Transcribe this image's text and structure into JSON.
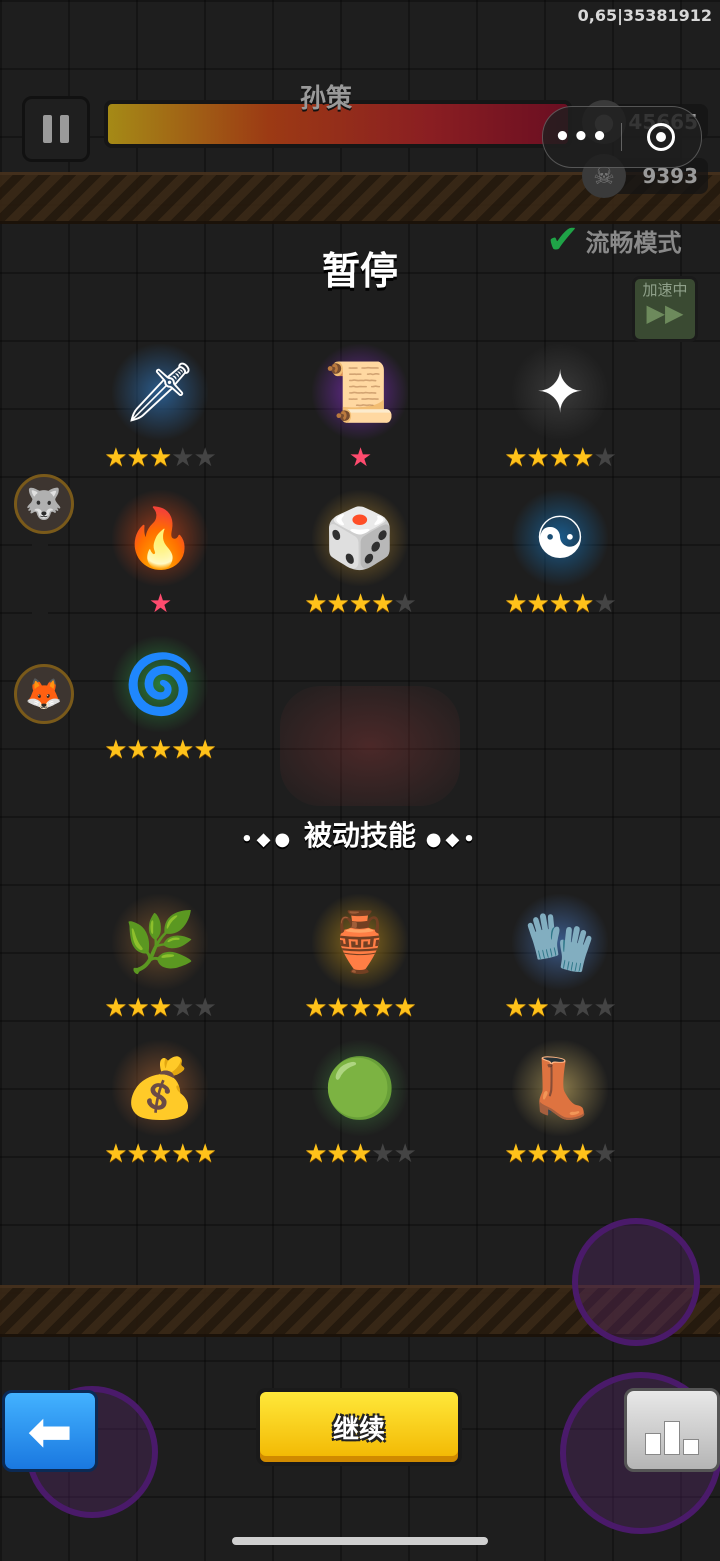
{
  "debug": "0,65|35381912",
  "boss_name": "孙策",
  "coins": "45665",
  "kills": "9393",
  "capsule": {
    "more": "•••"
  },
  "smooth_mode": "流畅模式",
  "speed_label": "加速中",
  "title": "暂停",
  "passive_heading": "被动技能",
  "continue_label": "继续",
  "active_skills": [
    {
      "icon": "ice-sword-icon",
      "glyph": "🗡",
      "bg": "#2a5a8a",
      "stars": 3,
      "max": 5,
      "type": "gold"
    },
    {
      "icon": "purple-scroll-icon",
      "glyph": "📜",
      "bg": "#6a2a9a",
      "stars": 1,
      "max": 1,
      "type": "red"
    },
    {
      "icon": "shuriken-icon",
      "glyph": "✦",
      "bg": "#3a3a3a",
      "stars": 4,
      "max": 5,
      "type": "gold"
    },
    {
      "icon": "fire-blades-icon",
      "glyph": "🔥",
      "bg": "#9a3a1a",
      "stars": 1,
      "max": 1,
      "type": "red"
    },
    {
      "icon": "dice-icon",
      "glyph": "🎲",
      "bg": "#8a6a2a",
      "stars": 4,
      "max": 5,
      "type": "gold"
    },
    {
      "icon": "yin-yang-shield-icon",
      "glyph": "☯",
      "bg": "#1a5a8a",
      "stars": 4,
      "max": 5,
      "type": "gold"
    },
    {
      "icon": "green-whirlwind-icon",
      "glyph": "🌀",
      "bg": "#2a7a3a",
      "stars": 5,
      "max": 5,
      "type": "gold"
    }
  ],
  "passive_skills": [
    {
      "icon": "ginseng-root-icon",
      "glyph": "🌿",
      "bg": "#6a4a2a",
      "stars": 3,
      "max": 5
    },
    {
      "icon": "golden-cauldron-icon",
      "glyph": "🏺",
      "bg": "#8a6a1a",
      "stars": 5,
      "max": 5
    },
    {
      "icon": "gauntlet-icon",
      "glyph": "🧤",
      "bg": "#3a5a8a",
      "stars": 2,
      "max": 5
    },
    {
      "icon": "coin-pouch-icon",
      "glyph": "💰",
      "bg": "#7a4a2a",
      "stars": 5,
      "max": 5
    },
    {
      "icon": "jade-pendant-icon",
      "glyph": "🟢",
      "bg": "#3a6a3a",
      "stars": 3,
      "max": 5
    },
    {
      "icon": "boot-icon",
      "glyph": "👢",
      "bg": "#8a7a4a",
      "stars": 4,
      "max": 5
    }
  ],
  "colors": {
    "star": "#ffc21a",
    "star_off": "#444444",
    "red_star": "#ff4b6e",
    "continue": "#ffd21a",
    "back": "#2a8ef0"
  }
}
